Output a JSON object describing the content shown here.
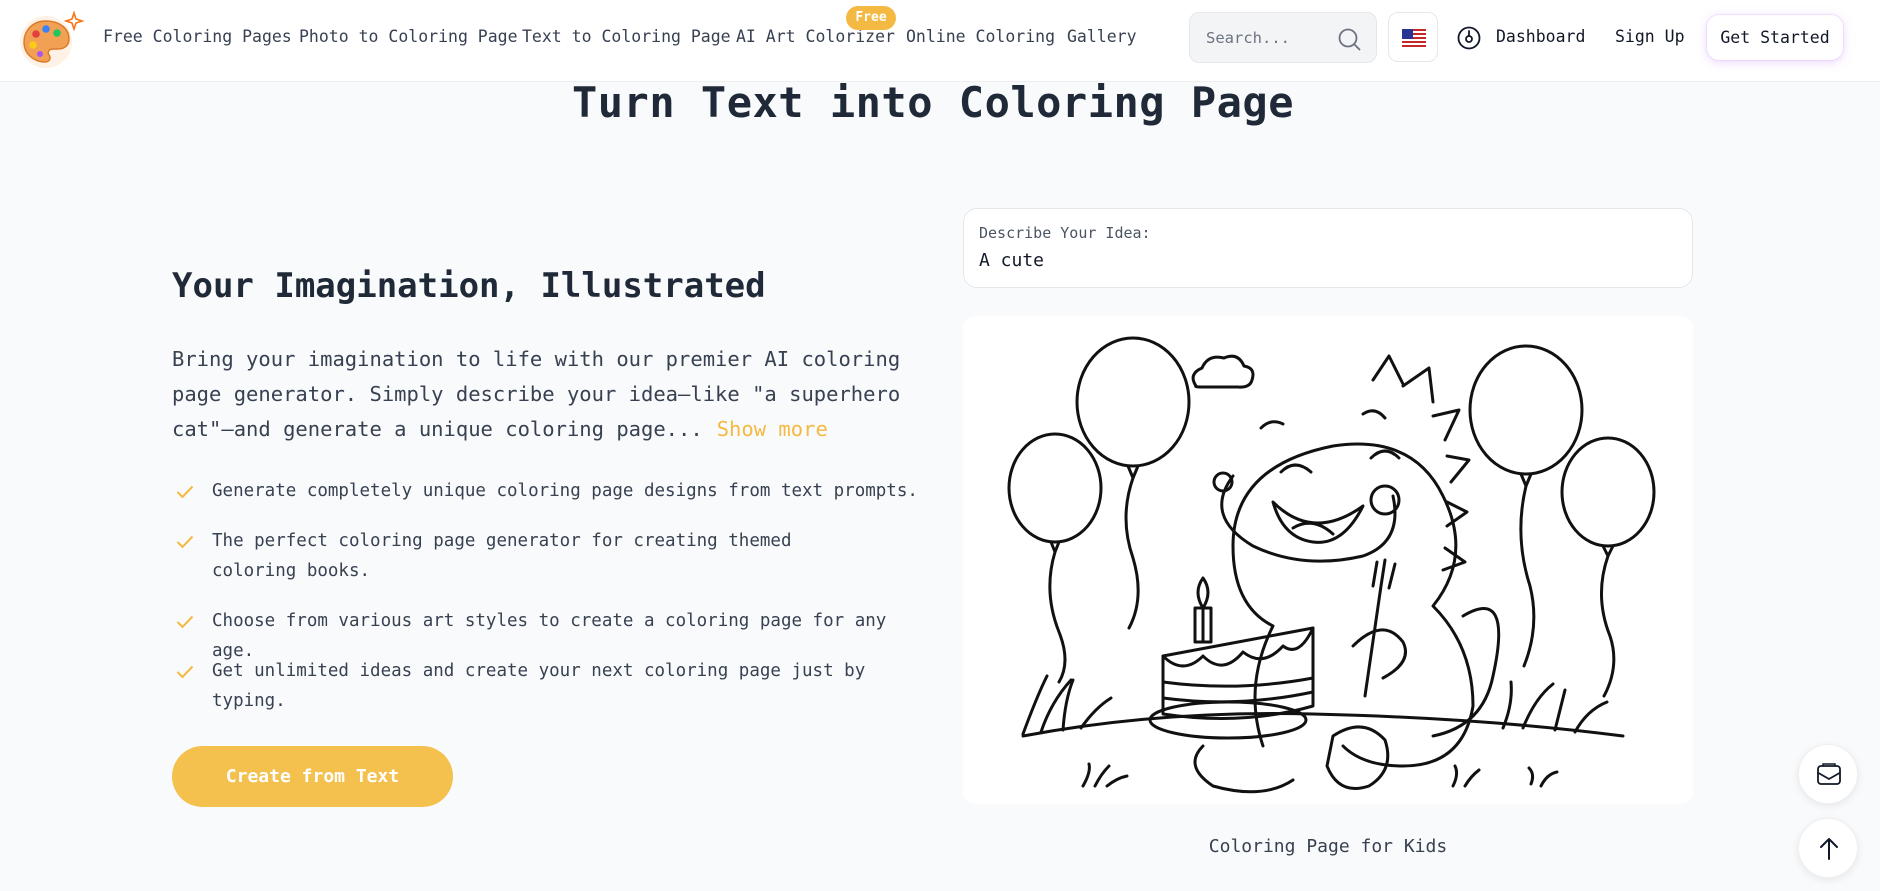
{
  "header": {
    "nav": [
      {
        "label": "Free Coloring Pages"
      },
      {
        "label": "Photo to Coloring Page"
      },
      {
        "label": "Text to Coloring Page"
      },
      {
        "label": "AI Art Colorizer",
        "badge": "Free"
      },
      {
        "label": "Online Coloring"
      },
      {
        "label": "Gallery"
      }
    ],
    "search": {
      "placeholder": "Search..."
    },
    "dashboard_label": "Dashboard",
    "signup_label": "Sign Up",
    "get_started_label": "Get Started",
    "icons": {
      "logo": "palette-logo-icon",
      "search": "search-icon",
      "language": "us-flag-icon",
      "dashboard": "dashboard-icon"
    }
  },
  "main": {
    "title": "Turn Text into Coloring Page",
    "section_title": "Your Imagination, Illustrated",
    "description": "Bring your imagination to life with our premier AI coloring page generator. Simply describe your idea—like \"a superhero cat\"—and generate a unique coloring page...",
    "show_more": "Show more",
    "features": [
      "Generate completely unique coloring page designs from text prompts.",
      "The perfect coloring page generator for creating themed coloring books.",
      "Choose from various art styles to create a coloring page for any age.",
      "Get unlimited ideas and create your next coloring page just by typing."
    ],
    "cta_label": "Create from Text",
    "idea": {
      "label": "Describe Your Idea:",
      "value": "A cute"
    },
    "illustration_caption": "Coloring Page for Kids"
  },
  "floating": {
    "mail_icon": "mail-icon",
    "back_to_top_icon": "arrow-up-icon"
  },
  "colors": {
    "accent": "#f4b942",
    "cta": "#f4c04e",
    "text_dark": "#1f2937",
    "background": "#f9fafb"
  }
}
